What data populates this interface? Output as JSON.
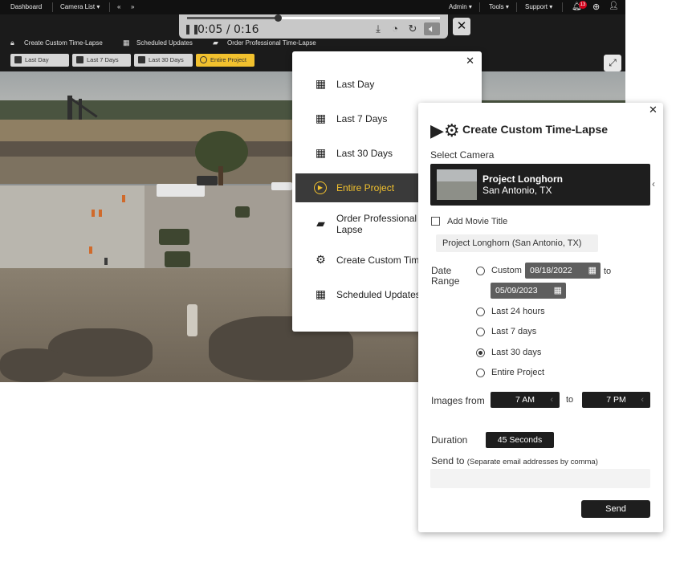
{
  "nav": {
    "dashboard": "Dashboard",
    "camera_list": "Camera List",
    "prev": "«",
    "next": "»",
    "admin": "Admin",
    "tools": "Tools",
    "support": "Support",
    "notification_count": "13"
  },
  "player": {
    "time": "0:05 / 0:16",
    "progress": 0.36
  },
  "actions": {
    "create_custom": "Create Custom Time-Lapse",
    "scheduled": "Scheduled Updates",
    "order_professional": "Order Professional Time-Lapse"
  },
  "ranges": [
    "Last Day",
    "Last 7 Days",
    "Last 30 Days",
    "Entire Project"
  ],
  "active_range": "Entire Project",
  "menu": {
    "items": [
      {
        "label": "Last Day",
        "icon": "calendar-1-icon"
      },
      {
        "label": "Last 7 Days",
        "icon": "calendar-7-icon"
      },
      {
        "label": "Last 30 Days",
        "icon": "calendar-30-icon"
      },
      {
        "label": "Entire Project",
        "icon": "play-circle-icon"
      },
      {
        "label": "Order Professional Lapse",
        "icon": "clapperboard-icon"
      },
      {
        "label": "Create Custom Tim",
        "icon": "camera-gear-icon"
      },
      {
        "label": "Scheduled Updates",
        "icon": "calendar-clock-icon"
      }
    ]
  },
  "panel": {
    "title": "Create Custom Time-Lapse",
    "select_camera": "Select Camera",
    "camera_name": "Project Longhorn",
    "camera_location": "San Antonio, TX",
    "add_movie_title": "Add Movie Title",
    "movie_title_value": "Project Longhorn (San Antonio, TX)",
    "date_range_label_1": "Date",
    "date_range_label_2": "Range",
    "custom": "Custom",
    "date_from": "08/18/2022",
    "to": "to",
    "date_to": "05/09/2023",
    "options": [
      "Last 24 hours",
      "Last 7 days",
      "Last 30 days",
      "Entire Project"
    ],
    "selected_option": "Last 30 days",
    "images_from": "Images from",
    "time_from": "7 AM",
    "time_to": "7 PM",
    "duration_label": "Duration",
    "duration_value": "45 Seconds",
    "send_to_label": "Send to",
    "send_to_hint": "(Separate email addresses by comma)",
    "send_button": "Send"
  },
  "colors": {
    "accent": "#f2c12e",
    "dark": "#1e1e1e",
    "badge": "#d0021b"
  }
}
